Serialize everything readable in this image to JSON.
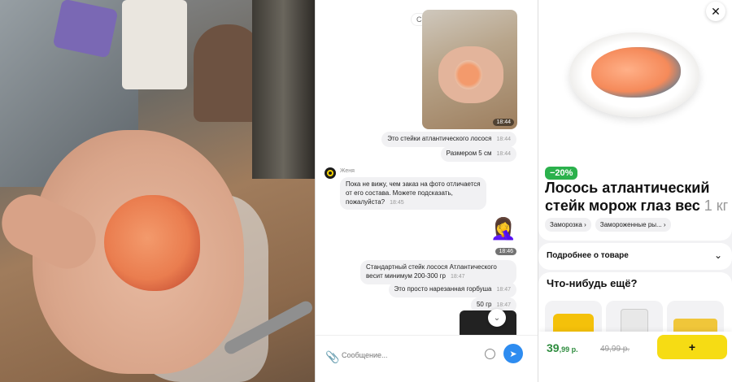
{
  "chat": {
    "date_label": "Сегодня",
    "photo_time": "18:44",
    "messages": [
      {
        "text": "Это стейки атлантического лосося",
        "time": "18:44"
      },
      {
        "text": "Размером 5 см",
        "time": "18:44"
      },
      {
        "text": "Пока не вижу, чем заказ на фото отличается от его состава. Можете подсказать, пожалуйста?",
        "time": "18:45"
      },
      {
        "emoji": "🤦‍♀️",
        "time": "18:46"
      },
      {
        "text": "Стандартный стейк лосося Атлантического весит минимум 200-300 гр",
        "time": "18:47"
      },
      {
        "text": "Это просто нарезанная горбуша",
        "time": "18:47"
      },
      {
        "text": "50 гр",
        "time": "18:47"
      }
    ],
    "sender_name": "Женя",
    "composer": {
      "placeholder": "Сообщение..."
    }
  },
  "product": {
    "discount": "−20%",
    "title": "Лосось атлантический стейк морож глаз вес",
    "weight": "1 кг",
    "chips": [
      "Заморозка",
      "Замороженные ры..."
    ],
    "details_label": "Подробнее о товаре",
    "more_label": "Что-нибудь ещё?",
    "price_main": "39",
    "price_cents": ",99 р.",
    "old_price": "49,99 р.",
    "add_label": "+"
  },
  "colors": {
    "accent_green": "#2bb14c",
    "accent_yellow": "#f6dc14",
    "send_blue": "#2e8cf0"
  }
}
